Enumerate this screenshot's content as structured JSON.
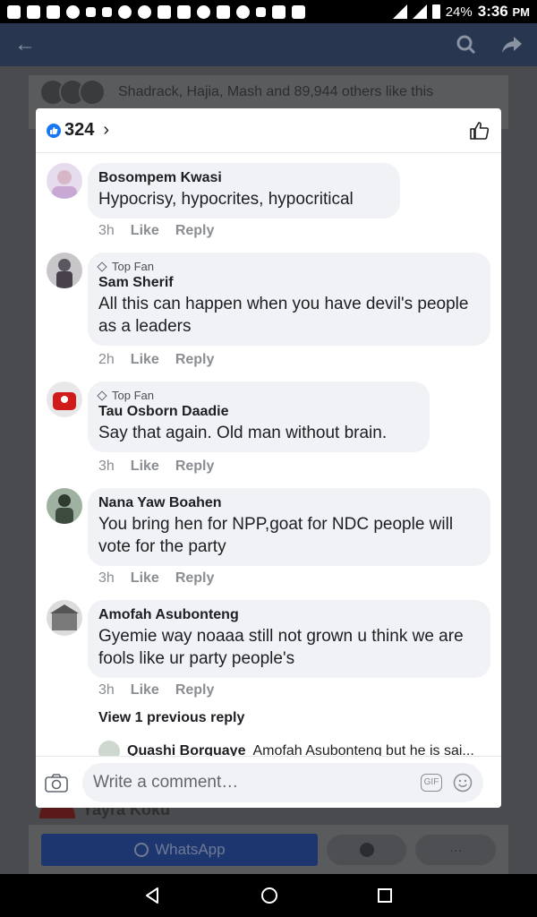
{
  "status_bar": {
    "battery": "24%",
    "time": "3:36",
    "ampm": "PM"
  },
  "background": {
    "likes_text": "Shadrack, Hajia, Mash and 89,944 others like this",
    "partial_name": "Yayra Koku",
    "whatsapp_label": "WhatsApp",
    "more_label": "···"
  },
  "header": {
    "reaction_count": "324"
  },
  "comments": [
    {
      "name": "Bosompem Kwasi",
      "top_fan": "",
      "text": "Hypocrisy, hypocrites, hypocritical",
      "time": "3h",
      "like": "Like",
      "reply": "Reply"
    },
    {
      "name": "Sam Sherif",
      "top_fan": "Top Fan",
      "text": "All this can happen when you have devil's people as a leaders",
      "time": "2h",
      "like": "Like",
      "reply": "Reply"
    },
    {
      "name": "Tau Osborn Daadie",
      "top_fan": "Top Fan",
      "text": "Say that again. Old man without brain.",
      "time": "3h",
      "like": "Like",
      "reply": "Reply"
    },
    {
      "name": "Nana Yaw Boahen",
      "top_fan": "",
      "text": "You bring hen for NPP,goat for NDC people will vote for the  party",
      "time": "3h",
      "like": "Like",
      "reply": "Reply"
    },
    {
      "name": "Amofah Asubonteng",
      "top_fan": "",
      "text": "Gyemie way noaaa still not grown u think we are fools like ur party people's",
      "time": "3h",
      "like": "Like",
      "reply": "Reply"
    }
  ],
  "view_previous": "View 1 previous reply",
  "reply_preview": {
    "name": "Quashi Borquaye",
    "text": "Amofah Asubonteng but he is sai..."
  },
  "composer": {
    "placeholder": "Write a comment…",
    "gif_label": "GIF"
  },
  "colors": {
    "accent": "#1877f2",
    "bubble": "#f0f2f5",
    "header_bg": "#28364f"
  }
}
